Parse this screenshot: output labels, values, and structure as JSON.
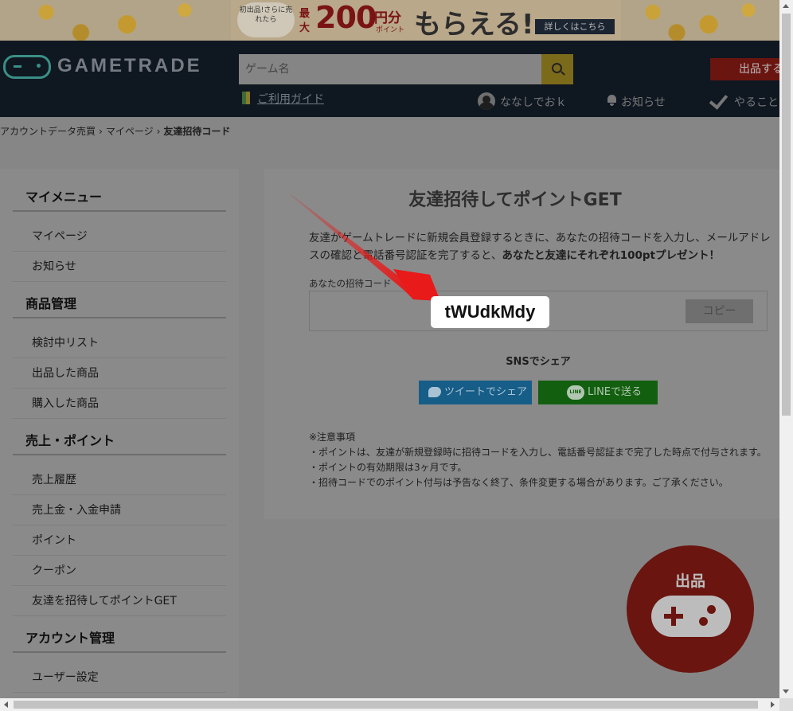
{
  "banner": {
    "badge": "初出品!さらに売れたら",
    "max": "最",
    "big": "大",
    "amount": "200",
    "unit": "円分",
    "point_word": "ポイント",
    "headline": "もらえる!",
    "link": "詳しくはこちら"
  },
  "header": {
    "logo": "GAMETRADE",
    "search_placeholder": "ゲーム名",
    "sell_button": "出品する",
    "guide": "ご利用ガイド",
    "user": "ななしでおｋ",
    "notices": "お知らせ",
    "todo": "やること"
  },
  "breadcrumb": {
    "home": "アカウントデータ売買",
    "mypage": "マイページ",
    "current": "友達招待コード"
  },
  "sidebar": {
    "sections": [
      {
        "title": "マイメニュー",
        "items": [
          "マイページ",
          "お知らせ"
        ]
      },
      {
        "title": "商品管理",
        "items": [
          "検討中リスト",
          "出品した商品",
          "購入した商品"
        ]
      },
      {
        "title": "売上・ポイント",
        "items": [
          "売上履歴",
          "売上金・入金申請",
          "ポイント",
          "クーポン",
          "友達を招待してポイントGET"
        ]
      },
      {
        "title": "アカウント管理",
        "items": [
          "ユーザー設定"
        ]
      }
    ]
  },
  "invite": {
    "title": "友達招待してポイントGET",
    "desc_plain": "友達がゲームトレードに新規会員登録するときに、あなたの招待コードを入力し、メールアドレスの確認と電話番号認証を完了すると、",
    "desc_bold": "あなたと友達にそれぞれ100ptプレゼント！",
    "code_label": "あなたの招待コード",
    "code": "tWUdkMdy",
    "copy_button": "コピー",
    "sns_label": "SNSでシェア",
    "twitter_button": "ツイートでシェア",
    "line_button": "LINEで送る",
    "line_icon_text": "LINE",
    "notes_title": "※注意事項",
    "notes": [
      "・ポイントは、友達が新規登録時に招待コードを入力し、電話番号認証まで完了した時点で付与されます。",
      "・ポイントの有効期限は3ヶ月です。",
      "・招待コードでのポイント付与は予告なく終了、条件変更する場合があります。ご了承ください。"
    ]
  },
  "fab": {
    "label": "出品"
  },
  "colors": {
    "overlay_header": "#0f1721",
    "sell_red": "#6a1510",
    "arrow_red": "#e81a1a",
    "highlight": "#ffffff"
  }
}
